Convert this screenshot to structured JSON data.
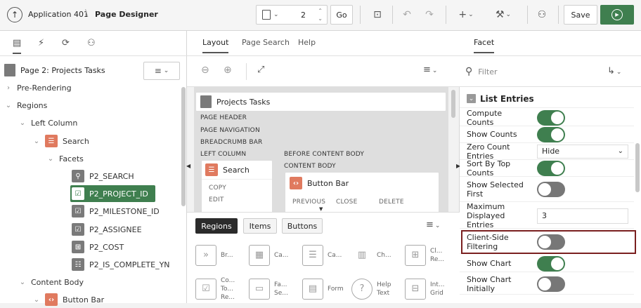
{
  "header": {
    "app_name": "Application 401",
    "page_designer": "Page Designer",
    "page_number": "2",
    "go_label": "Go",
    "save_label": "Save"
  },
  "left_panel": {
    "page_title": "Page 2: Projects Tasks",
    "tree": [
      {
        "label": "Pre-Rendering"
      },
      {
        "label": "Regions"
      },
      {
        "label": "Left Column"
      },
      {
        "label": "Search"
      },
      {
        "label": "Facets"
      },
      {
        "label": "P2_SEARCH"
      },
      {
        "label": "P2_PROJECT_ID"
      },
      {
        "label": "P2_MILESTONE_ID"
      },
      {
        "label": "P2_ASSIGNEE"
      },
      {
        "label": "P2_COST"
      },
      {
        "label": "P2_IS_COMPLETE_YN"
      },
      {
        "label": "Content Body"
      },
      {
        "label": "Button Bar"
      }
    ]
  },
  "center": {
    "tabs": [
      "Layout",
      "Page Search",
      "Help"
    ],
    "layout": {
      "page_title": "Projects Tasks",
      "page_header": "PAGE HEADER",
      "page_navigation": "PAGE NAVIGATION",
      "breadcrumb_bar": "BREADCRUMB BAR",
      "left_column": "LEFT COLUMN",
      "before_content_body": "BEFORE CONTENT BODY",
      "content_body": "CONTENT BODY",
      "search_region": "Search",
      "copy": "COPY",
      "edit": "EDIT",
      "button_bar": "Button Bar",
      "previous": "PREVIOUS",
      "close": "CLOSE",
      "delete": "DELETE"
    },
    "gallery_tabs": [
      "Regions",
      "Items",
      "Buttons"
    ],
    "gallery": [
      {
        "label": "Br..."
      },
      {
        "label": "Ca..."
      },
      {
        "label": "Ca..."
      },
      {
        "label": "Ch..."
      },
      {
        "label": "Cl... Re..."
      },
      {
        "label": "Co... To... Re..."
      },
      {
        "label": "Fa... Se..."
      },
      {
        "label": "Form"
      },
      {
        "label": "Help Text"
      },
      {
        "label": "Int... Grid"
      }
    ]
  },
  "right_panel": {
    "tab": "Facet",
    "filter_placeholder": "Filter",
    "section": "List Entries",
    "props": [
      {
        "label": "Compute Counts",
        "value": "on"
      },
      {
        "label": "Show Counts",
        "value": "on"
      },
      {
        "label": "Zero Count Entries",
        "value": "Hide"
      },
      {
        "label": "Sort By Top Counts",
        "value": "on"
      },
      {
        "label": "Show Selected First",
        "value": "off"
      },
      {
        "label": "Maximum Displayed Entries",
        "value": "3"
      },
      {
        "label": "Client-Side Filtering",
        "value": "off"
      },
      {
        "label": "Show Chart",
        "value": "on"
      },
      {
        "label": "Show Chart Initially",
        "value": "off"
      }
    ]
  },
  "colors": {
    "accent_green": "#3f7f4f",
    "highlight_border": "#7a1f1f",
    "node_orange": "#e07a5f"
  }
}
